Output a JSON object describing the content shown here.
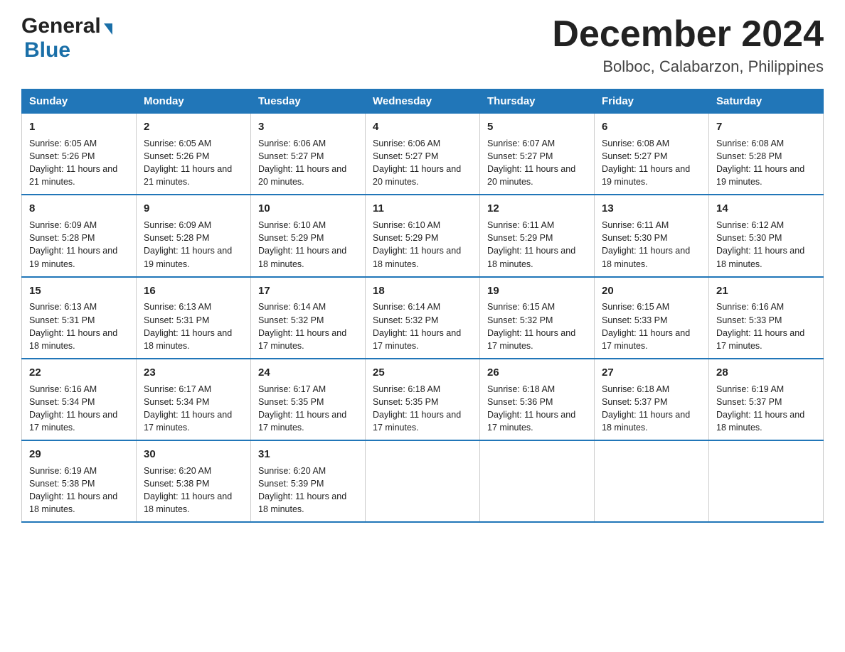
{
  "header": {
    "logo_general": "General",
    "logo_blue": "Blue",
    "month_title": "December 2024",
    "location": "Bolboc, Calabarzon, Philippines"
  },
  "days_of_week": [
    "Sunday",
    "Monday",
    "Tuesday",
    "Wednesday",
    "Thursday",
    "Friday",
    "Saturday"
  ],
  "weeks": [
    [
      {
        "num": "1",
        "sunrise": "6:05 AM",
        "sunset": "5:26 PM",
        "daylight": "11 hours and 21 minutes."
      },
      {
        "num": "2",
        "sunrise": "6:05 AM",
        "sunset": "5:26 PM",
        "daylight": "11 hours and 21 minutes."
      },
      {
        "num": "3",
        "sunrise": "6:06 AM",
        "sunset": "5:27 PM",
        "daylight": "11 hours and 20 minutes."
      },
      {
        "num": "4",
        "sunrise": "6:06 AM",
        "sunset": "5:27 PM",
        "daylight": "11 hours and 20 minutes."
      },
      {
        "num": "5",
        "sunrise": "6:07 AM",
        "sunset": "5:27 PM",
        "daylight": "11 hours and 20 minutes."
      },
      {
        "num": "6",
        "sunrise": "6:08 AM",
        "sunset": "5:27 PM",
        "daylight": "11 hours and 19 minutes."
      },
      {
        "num": "7",
        "sunrise": "6:08 AM",
        "sunset": "5:28 PM",
        "daylight": "11 hours and 19 minutes."
      }
    ],
    [
      {
        "num": "8",
        "sunrise": "6:09 AM",
        "sunset": "5:28 PM",
        "daylight": "11 hours and 19 minutes."
      },
      {
        "num": "9",
        "sunrise": "6:09 AM",
        "sunset": "5:28 PM",
        "daylight": "11 hours and 19 minutes."
      },
      {
        "num": "10",
        "sunrise": "6:10 AM",
        "sunset": "5:29 PM",
        "daylight": "11 hours and 18 minutes."
      },
      {
        "num": "11",
        "sunrise": "6:10 AM",
        "sunset": "5:29 PM",
        "daylight": "11 hours and 18 minutes."
      },
      {
        "num": "12",
        "sunrise": "6:11 AM",
        "sunset": "5:29 PM",
        "daylight": "11 hours and 18 minutes."
      },
      {
        "num": "13",
        "sunrise": "6:11 AM",
        "sunset": "5:30 PM",
        "daylight": "11 hours and 18 minutes."
      },
      {
        "num": "14",
        "sunrise": "6:12 AM",
        "sunset": "5:30 PM",
        "daylight": "11 hours and 18 minutes."
      }
    ],
    [
      {
        "num": "15",
        "sunrise": "6:13 AM",
        "sunset": "5:31 PM",
        "daylight": "11 hours and 18 minutes."
      },
      {
        "num": "16",
        "sunrise": "6:13 AM",
        "sunset": "5:31 PM",
        "daylight": "11 hours and 18 minutes."
      },
      {
        "num": "17",
        "sunrise": "6:14 AM",
        "sunset": "5:32 PM",
        "daylight": "11 hours and 17 minutes."
      },
      {
        "num": "18",
        "sunrise": "6:14 AM",
        "sunset": "5:32 PM",
        "daylight": "11 hours and 17 minutes."
      },
      {
        "num": "19",
        "sunrise": "6:15 AM",
        "sunset": "5:32 PM",
        "daylight": "11 hours and 17 minutes."
      },
      {
        "num": "20",
        "sunrise": "6:15 AM",
        "sunset": "5:33 PM",
        "daylight": "11 hours and 17 minutes."
      },
      {
        "num": "21",
        "sunrise": "6:16 AM",
        "sunset": "5:33 PM",
        "daylight": "11 hours and 17 minutes."
      }
    ],
    [
      {
        "num": "22",
        "sunrise": "6:16 AM",
        "sunset": "5:34 PM",
        "daylight": "11 hours and 17 minutes."
      },
      {
        "num": "23",
        "sunrise": "6:17 AM",
        "sunset": "5:34 PM",
        "daylight": "11 hours and 17 minutes."
      },
      {
        "num": "24",
        "sunrise": "6:17 AM",
        "sunset": "5:35 PM",
        "daylight": "11 hours and 17 minutes."
      },
      {
        "num": "25",
        "sunrise": "6:18 AM",
        "sunset": "5:35 PM",
        "daylight": "11 hours and 17 minutes."
      },
      {
        "num": "26",
        "sunrise": "6:18 AM",
        "sunset": "5:36 PM",
        "daylight": "11 hours and 17 minutes."
      },
      {
        "num": "27",
        "sunrise": "6:18 AM",
        "sunset": "5:37 PM",
        "daylight": "11 hours and 18 minutes."
      },
      {
        "num": "28",
        "sunrise": "6:19 AM",
        "sunset": "5:37 PM",
        "daylight": "11 hours and 18 minutes."
      }
    ],
    [
      {
        "num": "29",
        "sunrise": "6:19 AM",
        "sunset": "5:38 PM",
        "daylight": "11 hours and 18 minutes."
      },
      {
        "num": "30",
        "sunrise": "6:20 AM",
        "sunset": "5:38 PM",
        "daylight": "11 hours and 18 minutes."
      },
      {
        "num": "31",
        "sunrise": "6:20 AM",
        "sunset": "5:39 PM",
        "daylight": "11 hours and 18 minutes."
      },
      null,
      null,
      null,
      null
    ]
  ]
}
